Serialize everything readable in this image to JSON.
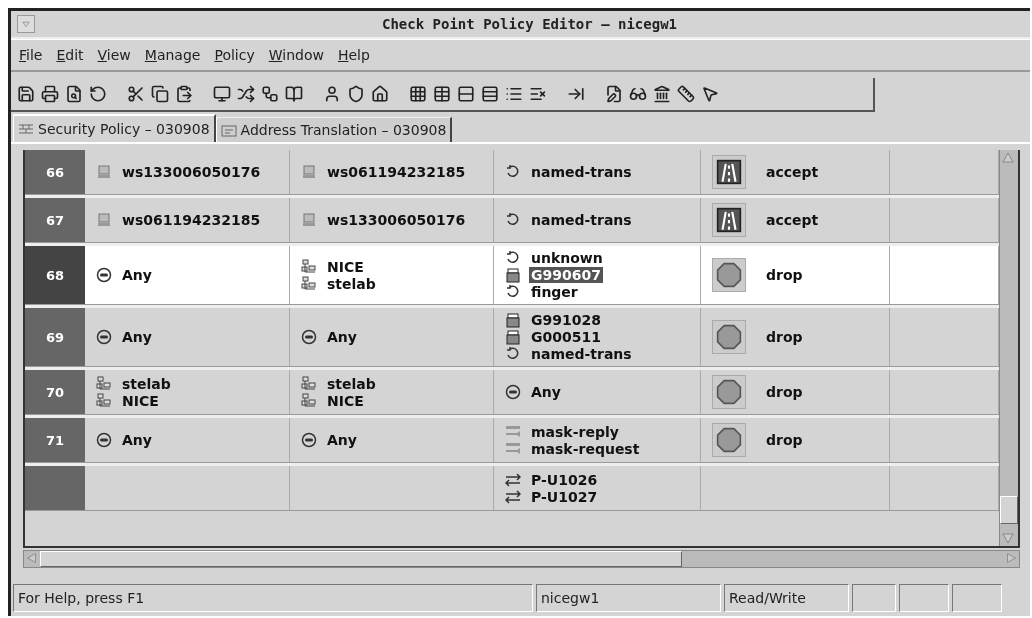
{
  "window": {
    "title": "Check Point Policy Editor – nicegw1"
  },
  "menu": [
    "File",
    "Edit",
    "View",
    "Manage",
    "Policy",
    "Window",
    "Help"
  ],
  "tabs": [
    {
      "label": "Security Policy – 030908",
      "selected": true
    },
    {
      "label": "Address Translation – 030908",
      "selected": false
    }
  ],
  "rules": [
    {
      "number": "66",
      "selected": false,
      "source": [
        {
          "kind": "host",
          "text": "ws133006050176",
          "selected": false
        }
      ],
      "destination": [
        {
          "kind": "host",
          "text": "ws061194232185",
          "selected": false
        }
      ],
      "service": [
        {
          "kind": "tcp",
          "text": "named-trans",
          "selected": false
        }
      ],
      "action": {
        "kind": "accept",
        "text": "accept"
      }
    },
    {
      "number": "67",
      "selected": false,
      "source": [
        {
          "kind": "host",
          "text": "ws061194232185",
          "selected": false
        }
      ],
      "destination": [
        {
          "kind": "host",
          "text": "ws133006050176",
          "selected": false
        }
      ],
      "service": [
        {
          "kind": "tcp",
          "text": "named-trans",
          "selected": false
        }
      ],
      "action": {
        "kind": "accept",
        "text": "accept"
      }
    },
    {
      "number": "68",
      "selected": true,
      "source": [
        {
          "kind": "any",
          "text": "Any",
          "selected": false
        }
      ],
      "destination": [
        {
          "kind": "network",
          "text": "NICE",
          "selected": false
        },
        {
          "kind": "network",
          "text": "stelab",
          "selected": false
        }
      ],
      "service": [
        {
          "kind": "tcp",
          "text": "unknown",
          "selected": false
        },
        {
          "kind": "group",
          "text": "G990607",
          "selected": true
        },
        {
          "kind": "tcp",
          "text": "finger",
          "selected": false
        }
      ],
      "action": {
        "kind": "drop",
        "text": "drop"
      }
    },
    {
      "number": "69",
      "selected": false,
      "source": [
        {
          "kind": "any",
          "text": "Any",
          "selected": false
        }
      ],
      "destination": [
        {
          "kind": "any",
          "text": "Any",
          "selected": false
        }
      ],
      "service": [
        {
          "kind": "group",
          "text": "G991028",
          "selected": false
        },
        {
          "kind": "group",
          "text": "G000511",
          "selected": false
        },
        {
          "kind": "tcp",
          "text": "named-trans",
          "selected": false
        }
      ],
      "action": {
        "kind": "drop",
        "text": "drop"
      }
    },
    {
      "number": "70",
      "selected": false,
      "source": [
        {
          "kind": "network",
          "text": "stelab",
          "selected": false
        },
        {
          "kind": "network",
          "text": "NICE",
          "selected": false
        }
      ],
      "destination": [
        {
          "kind": "network",
          "text": "stelab",
          "selected": false
        },
        {
          "kind": "network",
          "text": "NICE",
          "selected": false
        }
      ],
      "service": [
        {
          "kind": "any",
          "text": "Any",
          "selected": false
        }
      ],
      "action": {
        "kind": "drop",
        "text": "drop"
      }
    },
    {
      "number": "71",
      "selected": false,
      "source": [
        {
          "kind": "any",
          "text": "Any",
          "selected": false
        }
      ],
      "destination": [
        {
          "kind": "any",
          "text": "Any",
          "selected": false
        }
      ],
      "service": [
        {
          "kind": "icmp",
          "text": "mask-reply",
          "selected": false
        },
        {
          "kind": "icmp",
          "text": "mask-request",
          "selected": false
        }
      ],
      "action": {
        "kind": "drop",
        "text": "drop"
      }
    },
    {
      "selected": false,
      "service": [
        {
          "kind": "udp",
          "text": "P-U1026",
          "selected": false
        },
        {
          "kind": "udp",
          "text": "P-U1027",
          "selected": false
        }
      ]
    }
  ],
  "status_bar": {
    "help": "For Help, press F1",
    "gateway": "nicegw1",
    "mode": "Read/Write"
  }
}
